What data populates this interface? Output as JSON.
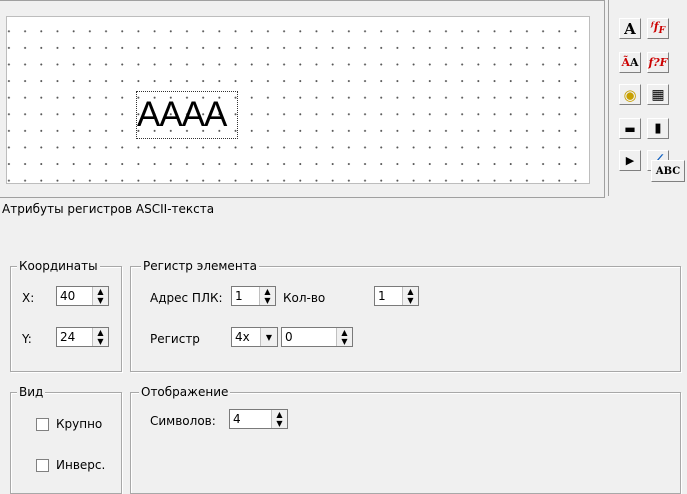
{
  "canvas": {
    "sample_text": "AAAA"
  },
  "toolbar": {
    "tools": [
      {
        "name": "text-tool-icon",
        "glyph": "A"
      },
      {
        "name": "formula-tool-icon",
        "glyph": "f"
      },
      {
        "name": "ascii-tool-icon",
        "glyph": "ÃA"
      },
      {
        "name": "formula-alt-tool-icon",
        "glyph": "f?"
      },
      {
        "name": "lamp-tool-icon",
        "glyph": "◉"
      },
      {
        "name": "bitmap-tool-icon",
        "glyph": "▦"
      },
      {
        "name": "keypad-tool-icon",
        "glyph": "▭"
      },
      {
        "name": "level-tool-icon",
        "glyph": "▮"
      },
      {
        "name": "button-tool-icon",
        "glyph": "▶"
      },
      {
        "name": "trend-tool-icon",
        "glyph": "⟋"
      },
      {
        "name": "abc-tool-icon",
        "glyph": "ABC"
      }
    ]
  },
  "attributes": {
    "title": "Атрибуты регистров ASCII-текста",
    "coords": {
      "title": "Координаты",
      "x_label": "X:",
      "x_value": "40",
      "y_label": "Y:",
      "y_value": "24"
    },
    "register": {
      "title": "Регистр элемента",
      "plc_label": "Адрес ПЛК:",
      "plc_value": "1",
      "count_label": "Кол-во",
      "count_value": "1",
      "reg_label": "Регистр",
      "reg_type": "4x",
      "reg_value": "0"
    },
    "view": {
      "title": "Вид",
      "large_label": "Крупно",
      "inverse_label": "Инверс."
    },
    "display": {
      "title": "Отображение",
      "chars_label": "Символов:",
      "chars_value": "4"
    }
  }
}
